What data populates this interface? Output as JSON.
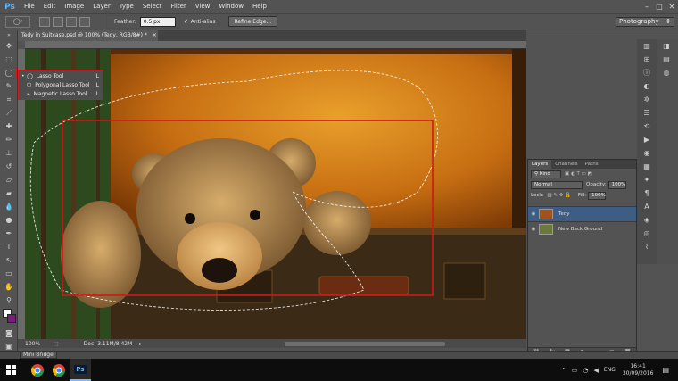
{
  "app": {
    "logo": "Ps"
  },
  "menu": [
    "File",
    "Edit",
    "Image",
    "Layer",
    "Type",
    "Select",
    "Filter",
    "View",
    "Window",
    "Help"
  ],
  "window_controls": {
    "minimize": "–",
    "maximize": "□",
    "close": "✕"
  },
  "options": {
    "feather_label": "Feather:",
    "feather_value": "0.5 px",
    "antialias_check": "✓",
    "antialias_label": "Anti-alias",
    "refine_edge": "Refine Edge...",
    "workspace": "Photography"
  },
  "document": {
    "tab_title": "Tedy in Suitcase.psd @ 100% (Tedy, RGB/8#) *",
    "tab_close": "×"
  },
  "flyout": [
    {
      "icon": "lasso-icon",
      "label": "Lasso Tool",
      "shortcut": "L",
      "bullet": "•"
    },
    {
      "icon": "polygonal-lasso-icon",
      "label": "Polygonal Lasso Tool",
      "shortcut": "L",
      "bullet": ""
    },
    {
      "icon": "magnetic-lasso-icon",
      "label": "Magnetic Lasso Tool",
      "shortcut": "L",
      "bullet": ""
    }
  ],
  "status": {
    "zoom": "100%",
    "doc": "Doc: 3.11M/8.42M",
    "arrow": "▸"
  },
  "minibridge": "Mini Bridge",
  "layers_panel": {
    "tabs": [
      "Layers",
      "Channels",
      "Paths"
    ],
    "kind": "Kind",
    "blend_mode": "Normal",
    "opacity_label": "Opacity:",
    "opacity_value": "100%",
    "lock_label": "Lock:",
    "fill_label": "Fill:",
    "fill_value": "100%",
    "layers": [
      {
        "name": "Tedy",
        "active": true
      },
      {
        "name": "New Back Ground",
        "active": false
      }
    ],
    "footer_fx": "fx"
  },
  "taskbar": {
    "time": "16:41",
    "date": "30/09/2016",
    "lang": "ENG",
    "ps_label": "Ps"
  },
  "colors": {
    "selection_red": "#d01818",
    "active_layer": "#3e5d84",
    "ps_blue": "#5ab7ff"
  }
}
